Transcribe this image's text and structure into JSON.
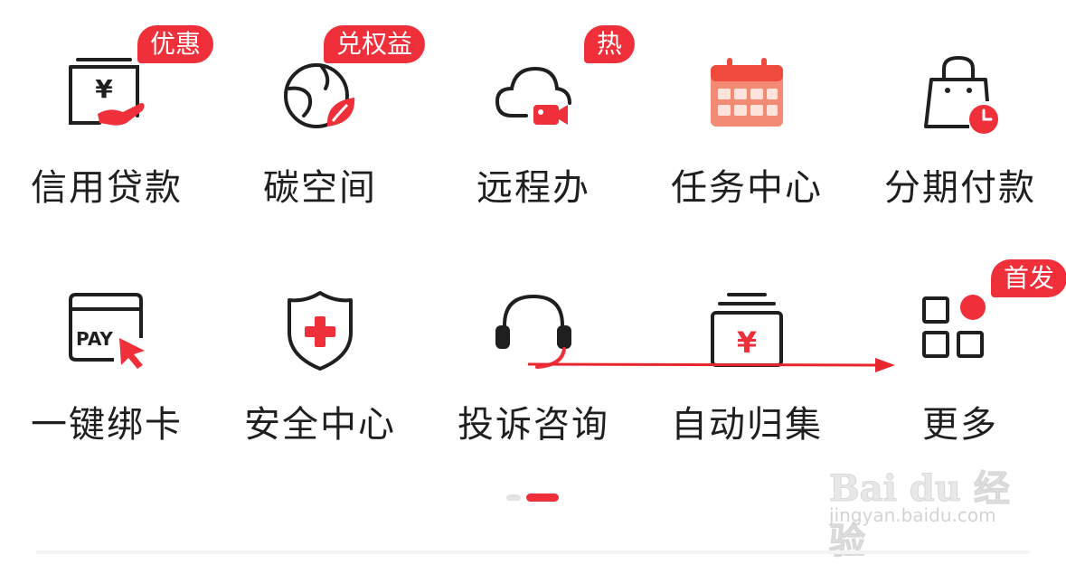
{
  "grid": {
    "row1": [
      {
        "label": "信用贷款",
        "icon": "yuan-card-hand-icon",
        "badge": "优惠"
      },
      {
        "label": "碳空间",
        "icon": "globe-leaf-icon",
        "badge": "兑权益"
      },
      {
        "label": "远程办",
        "icon": "cloud-video-icon",
        "badge": "热"
      },
      {
        "label": "任务中心",
        "icon": "calendar-icon",
        "badge": ""
      },
      {
        "label": "分期付款",
        "icon": "shopping-bag-clock-icon",
        "badge": ""
      }
    ],
    "row2": [
      {
        "label": "一键绑卡",
        "icon": "pay-card-icon",
        "badge": ""
      },
      {
        "label": "安全中心",
        "icon": "shield-plus-icon",
        "badge": ""
      },
      {
        "label": "投诉咨询",
        "icon": "headset-icon",
        "badge": ""
      },
      {
        "label": "自动归集",
        "icon": "yuan-box-icon",
        "badge": ""
      },
      {
        "label": "更多",
        "icon": "apps-grid-icon",
        "badge": "首发"
      }
    ]
  },
  "pager": {
    "pages": 2,
    "current": 2
  },
  "watermark": {
    "main": "Bai du 经验",
    "sub": "jingyan.baidu.com"
  },
  "colors": {
    "accent": "#ef2f3a",
    "icon_stroke": "#1f1f1f"
  }
}
